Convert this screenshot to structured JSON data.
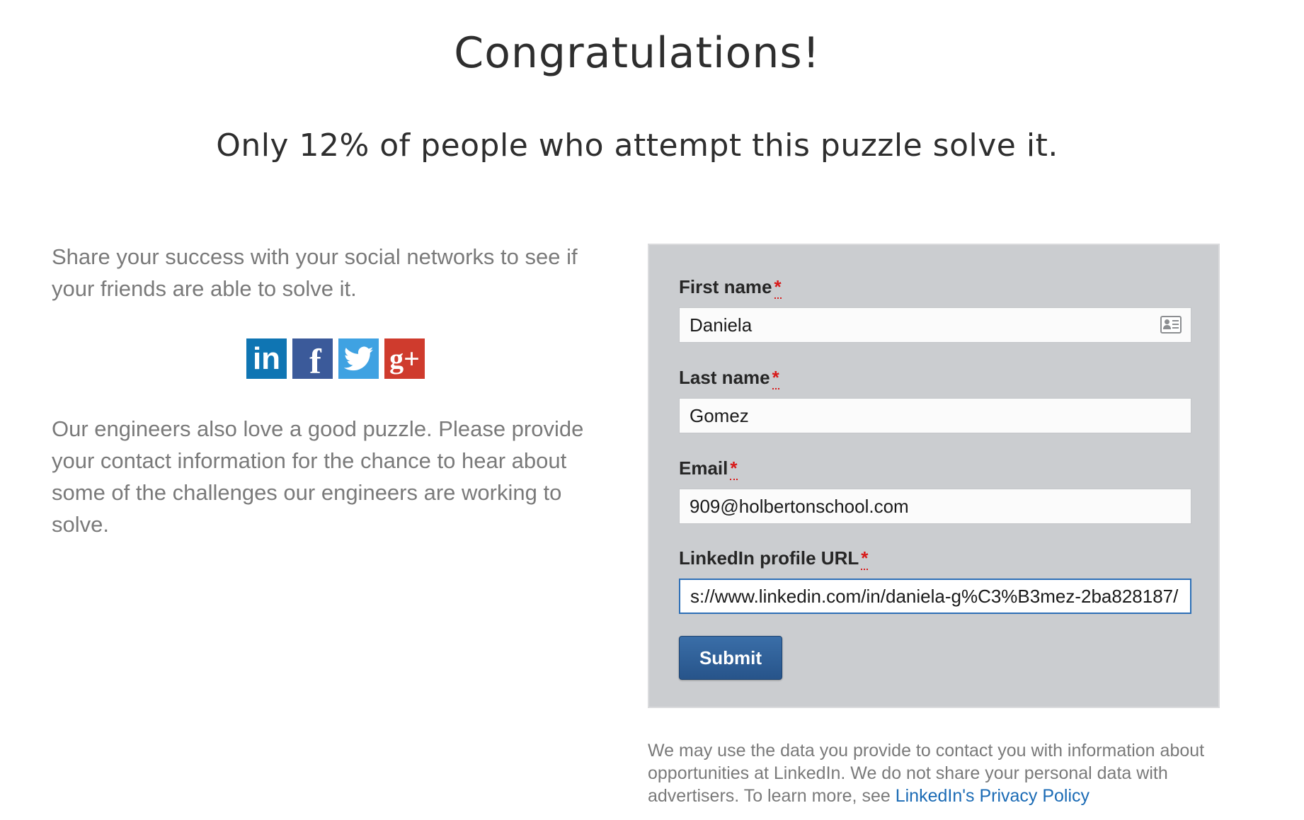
{
  "header": {
    "title": "Congratulations!",
    "subtitle": "Only 12% of people who attempt this puzzle solve it."
  },
  "left": {
    "share_text": "Share your success with your social networks to see if your friends are able to solve it.",
    "social": [
      {
        "name": "linkedin",
        "glyph": "in",
        "color": "#0f75b3"
      },
      {
        "name": "facebook",
        "glyph": "f",
        "color": "#3b5a9a"
      },
      {
        "name": "twitter",
        "glyph": "twitter-bird",
        "color": "#3fa2e2"
      },
      {
        "name": "google-plus",
        "glyph": "g+",
        "color": "#cf3b2d"
      }
    ],
    "engineers_text": "Our engineers also love a good puzzle. Please provide your contact information for the chance to hear about some of the challenges our engineers are working to solve."
  },
  "form": {
    "first_name": {
      "label": "First name",
      "required": "*",
      "value": "Daniela"
    },
    "last_name": {
      "label": "Last name",
      "required": "*",
      "value": "Gomez"
    },
    "email": {
      "label": "Email",
      "required": "*",
      "value": "909@holbertonschool.com"
    },
    "linkedin_url": {
      "label": "LinkedIn profile URL",
      "required": "*",
      "value": "s://www.linkedin.com/in/daniela-g%C3%B3mez-2ba828187/"
    },
    "submit_label": "Submit"
  },
  "privacy": {
    "text": "We may use the data you provide to contact you with information about opportunities at LinkedIn. We do not share your personal data with advertisers. To learn more, see ",
    "link_text": "LinkedIn's Privacy Policy",
    "link_color": "#1b6bb5"
  }
}
